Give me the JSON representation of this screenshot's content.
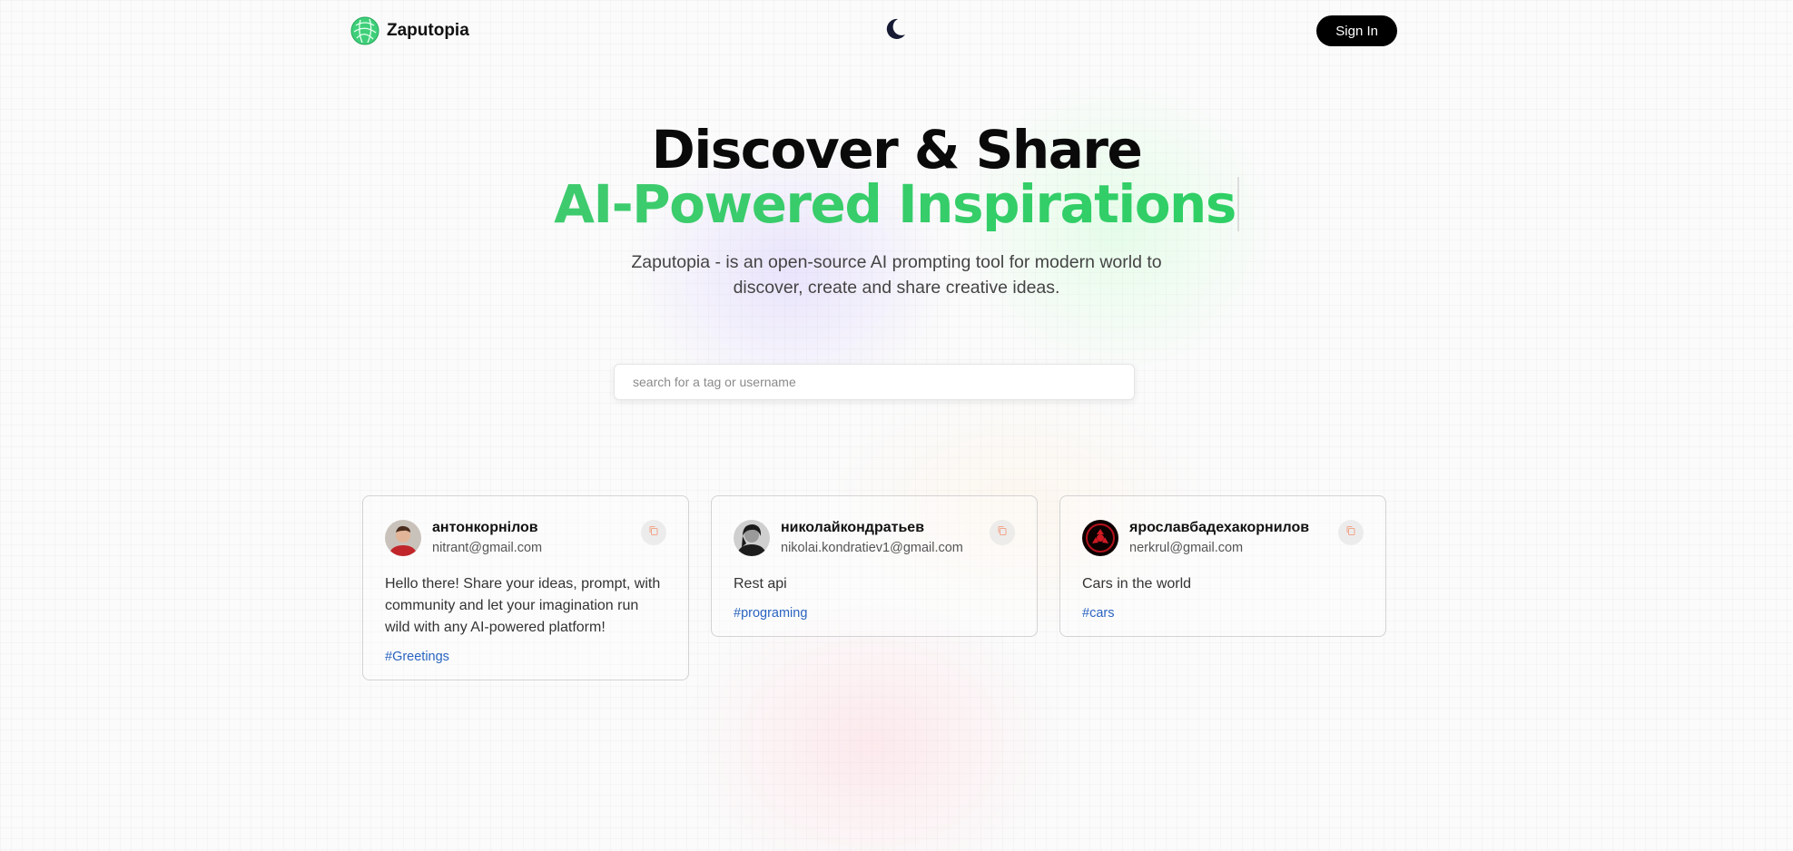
{
  "brand": {
    "name": "Zaputopia",
    "accent": "#2fcf66"
  },
  "nav": {
    "theme_toggle_icon": "moon-icon",
    "signin_label": "Sign In"
  },
  "hero": {
    "title_line1": "Discover & Share",
    "title_line2": "AI-Powered Inspirations",
    "description": "Zaputopia - is an open-source AI prompting tool for modern world to discover, create and share creative ideas."
  },
  "search": {
    "placeholder": "search for a tag or username",
    "value": ""
  },
  "posts": [
    {
      "username": "антонкорнілов",
      "email": "nitrant@gmail.com",
      "prompt": "Hello there! Share your ideas, prompt, with community and let your imagination run wild with any AI-powered platform!",
      "tag": "#Greetings"
    },
    {
      "username": "николайкондратьев",
      "email": "nikolai.kondratiev1@gmail.com",
      "prompt": "Rest api",
      "tag": "#programing"
    },
    {
      "username": "ярославбадехакорнилов",
      "email": "nerkrul@gmail.com",
      "prompt": "Cars in the world",
      "tag": "#cars"
    }
  ]
}
